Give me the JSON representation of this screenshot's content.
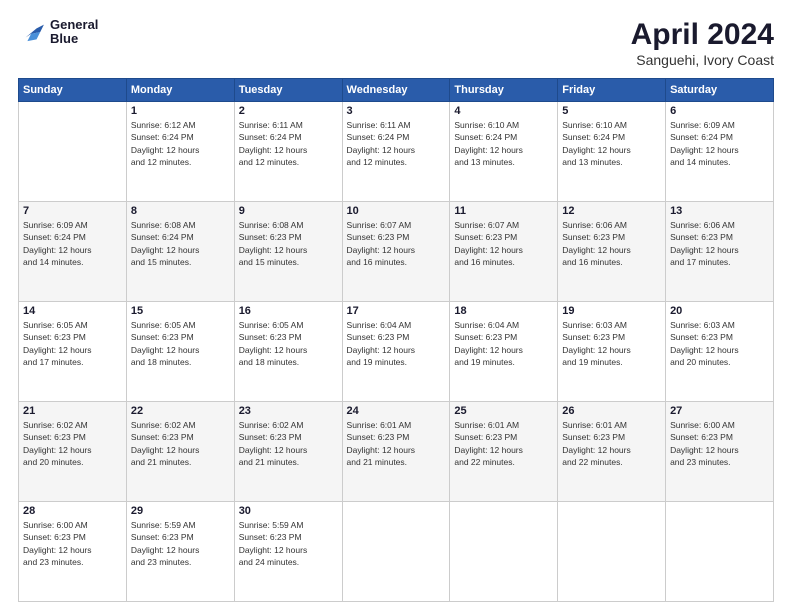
{
  "header": {
    "title": "April 2024",
    "subtitle": "Sanguehi, Ivory Coast",
    "logo_line1": "General",
    "logo_line2": "Blue"
  },
  "weekdays": [
    "Sunday",
    "Monday",
    "Tuesday",
    "Wednesday",
    "Thursday",
    "Friday",
    "Saturday"
  ],
  "weeks": [
    [
      {
        "day": "",
        "info": ""
      },
      {
        "day": "1",
        "info": "Sunrise: 6:12 AM\nSunset: 6:24 PM\nDaylight: 12 hours\nand 12 minutes."
      },
      {
        "day": "2",
        "info": "Sunrise: 6:11 AM\nSunset: 6:24 PM\nDaylight: 12 hours\nand 12 minutes."
      },
      {
        "day": "3",
        "info": "Sunrise: 6:11 AM\nSunset: 6:24 PM\nDaylight: 12 hours\nand 12 minutes."
      },
      {
        "day": "4",
        "info": "Sunrise: 6:10 AM\nSunset: 6:24 PM\nDaylight: 12 hours\nand 13 minutes."
      },
      {
        "day": "5",
        "info": "Sunrise: 6:10 AM\nSunset: 6:24 PM\nDaylight: 12 hours\nand 13 minutes."
      },
      {
        "day": "6",
        "info": "Sunrise: 6:09 AM\nSunset: 6:24 PM\nDaylight: 12 hours\nand 14 minutes."
      }
    ],
    [
      {
        "day": "7",
        "info": "Sunrise: 6:09 AM\nSunset: 6:24 PM\nDaylight: 12 hours\nand 14 minutes."
      },
      {
        "day": "8",
        "info": "Sunrise: 6:08 AM\nSunset: 6:24 PM\nDaylight: 12 hours\nand 15 minutes."
      },
      {
        "day": "9",
        "info": "Sunrise: 6:08 AM\nSunset: 6:23 PM\nDaylight: 12 hours\nand 15 minutes."
      },
      {
        "day": "10",
        "info": "Sunrise: 6:07 AM\nSunset: 6:23 PM\nDaylight: 12 hours\nand 16 minutes."
      },
      {
        "day": "11",
        "info": "Sunrise: 6:07 AM\nSunset: 6:23 PM\nDaylight: 12 hours\nand 16 minutes."
      },
      {
        "day": "12",
        "info": "Sunrise: 6:06 AM\nSunset: 6:23 PM\nDaylight: 12 hours\nand 16 minutes."
      },
      {
        "day": "13",
        "info": "Sunrise: 6:06 AM\nSunset: 6:23 PM\nDaylight: 12 hours\nand 17 minutes."
      }
    ],
    [
      {
        "day": "14",
        "info": "Sunrise: 6:05 AM\nSunset: 6:23 PM\nDaylight: 12 hours\nand 17 minutes."
      },
      {
        "day": "15",
        "info": "Sunrise: 6:05 AM\nSunset: 6:23 PM\nDaylight: 12 hours\nand 18 minutes."
      },
      {
        "day": "16",
        "info": "Sunrise: 6:05 AM\nSunset: 6:23 PM\nDaylight: 12 hours\nand 18 minutes."
      },
      {
        "day": "17",
        "info": "Sunrise: 6:04 AM\nSunset: 6:23 PM\nDaylight: 12 hours\nand 19 minutes."
      },
      {
        "day": "18",
        "info": "Sunrise: 6:04 AM\nSunset: 6:23 PM\nDaylight: 12 hours\nand 19 minutes."
      },
      {
        "day": "19",
        "info": "Sunrise: 6:03 AM\nSunset: 6:23 PM\nDaylight: 12 hours\nand 19 minutes."
      },
      {
        "day": "20",
        "info": "Sunrise: 6:03 AM\nSunset: 6:23 PM\nDaylight: 12 hours\nand 20 minutes."
      }
    ],
    [
      {
        "day": "21",
        "info": "Sunrise: 6:02 AM\nSunset: 6:23 PM\nDaylight: 12 hours\nand 20 minutes."
      },
      {
        "day": "22",
        "info": "Sunrise: 6:02 AM\nSunset: 6:23 PM\nDaylight: 12 hours\nand 21 minutes."
      },
      {
        "day": "23",
        "info": "Sunrise: 6:02 AM\nSunset: 6:23 PM\nDaylight: 12 hours\nand 21 minutes."
      },
      {
        "day": "24",
        "info": "Sunrise: 6:01 AM\nSunset: 6:23 PM\nDaylight: 12 hours\nand 21 minutes."
      },
      {
        "day": "25",
        "info": "Sunrise: 6:01 AM\nSunset: 6:23 PM\nDaylight: 12 hours\nand 22 minutes."
      },
      {
        "day": "26",
        "info": "Sunrise: 6:01 AM\nSunset: 6:23 PM\nDaylight: 12 hours\nand 22 minutes."
      },
      {
        "day": "27",
        "info": "Sunrise: 6:00 AM\nSunset: 6:23 PM\nDaylight: 12 hours\nand 23 minutes."
      }
    ],
    [
      {
        "day": "28",
        "info": "Sunrise: 6:00 AM\nSunset: 6:23 PM\nDaylight: 12 hours\nand 23 minutes."
      },
      {
        "day": "29",
        "info": "Sunrise: 5:59 AM\nSunset: 6:23 PM\nDaylight: 12 hours\nand 23 minutes."
      },
      {
        "day": "30",
        "info": "Sunrise: 5:59 AM\nSunset: 6:23 PM\nDaylight: 12 hours\nand 24 minutes."
      },
      {
        "day": "",
        "info": ""
      },
      {
        "day": "",
        "info": ""
      },
      {
        "day": "",
        "info": ""
      },
      {
        "day": "",
        "info": ""
      }
    ]
  ]
}
